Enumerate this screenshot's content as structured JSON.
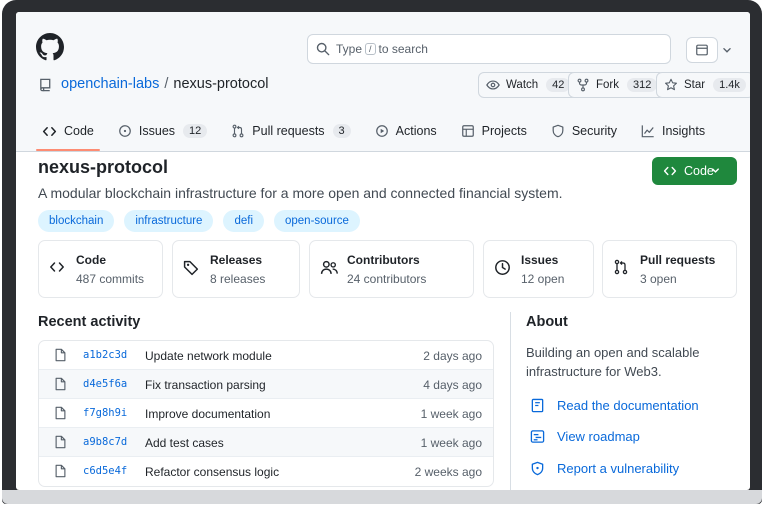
{
  "header": {
    "search_prefix": "Type",
    "search_key": "/",
    "search_suffix": "to search",
    "owner": "openchain-labs",
    "separator": "/",
    "repo": "nexus-protocol",
    "watch": {
      "label": "Watch",
      "count": "42"
    },
    "fork": {
      "label": "Fork",
      "count": "312"
    },
    "star": {
      "label": "Star",
      "count": "1.4k"
    }
  },
  "tabs": [
    {
      "label": "Code",
      "icon": "code-icon",
      "active": true
    },
    {
      "label": "Issues",
      "count": "12",
      "icon": "issue-icon"
    },
    {
      "label": "Pull requests",
      "count": "3",
      "icon": "pull-request-icon"
    },
    {
      "label": "Actions",
      "icon": "play-icon"
    },
    {
      "label": "Projects",
      "icon": "table-icon"
    },
    {
      "label": "Security",
      "icon": "shield-icon"
    },
    {
      "label": "Insights",
      "icon": "graph-icon"
    }
  ],
  "repo": {
    "title": "nexus-protocol",
    "code_button": "Code",
    "description": "A modular blockchain infrastructure for a more open and connected financial system.",
    "topics": [
      "blockchain",
      "infrastructure",
      "defi",
      "open-source"
    ]
  },
  "stats": [
    {
      "label": "Code",
      "sub": "487 commits",
      "icon": "code-icon"
    },
    {
      "label": "Releases",
      "sub": "8 releases",
      "icon": "tag-icon"
    },
    {
      "label": "Contributors",
      "sub": "24 contributors",
      "icon": "people-icon"
    },
    {
      "label": "Issues",
      "sub": "12 open",
      "icon": "clock-icon"
    },
    {
      "label": "Pull requests",
      "sub": "3 open",
      "icon": "pull-request-icon"
    }
  ],
  "recent": {
    "title": "Recent activity",
    "rows": [
      {
        "sha": "a1b2c3d",
        "message": "Update network module",
        "ago": "2 days ago"
      },
      {
        "sha": "d4e5f6a",
        "message": "Fix transaction parsing",
        "ago": "4 days ago"
      },
      {
        "sha": "f7g8h9i",
        "message": "Improve documentation",
        "ago": "1 week ago"
      },
      {
        "sha": "a9b8c7d",
        "message": "Add test cases",
        "ago": "1 week ago"
      },
      {
        "sha": "c6d5e4f",
        "message": "Refactor consensus logic",
        "ago": "2 weeks ago"
      }
    ]
  },
  "about": {
    "title": "About",
    "description": "Building an open and scalable infrastructure for Web3.",
    "links": [
      {
        "label": "Read the documentation",
        "icon": "book-icon"
      },
      {
        "label": "View roadmap",
        "icon": "roadmap-icon"
      },
      {
        "label": "Report a vulnerability",
        "icon": "shield-icon"
      }
    ]
  },
  "colors": {
    "accent": "#0969da",
    "primary_button": "#1f883d",
    "active_tab": "#fd8c73"
  }
}
